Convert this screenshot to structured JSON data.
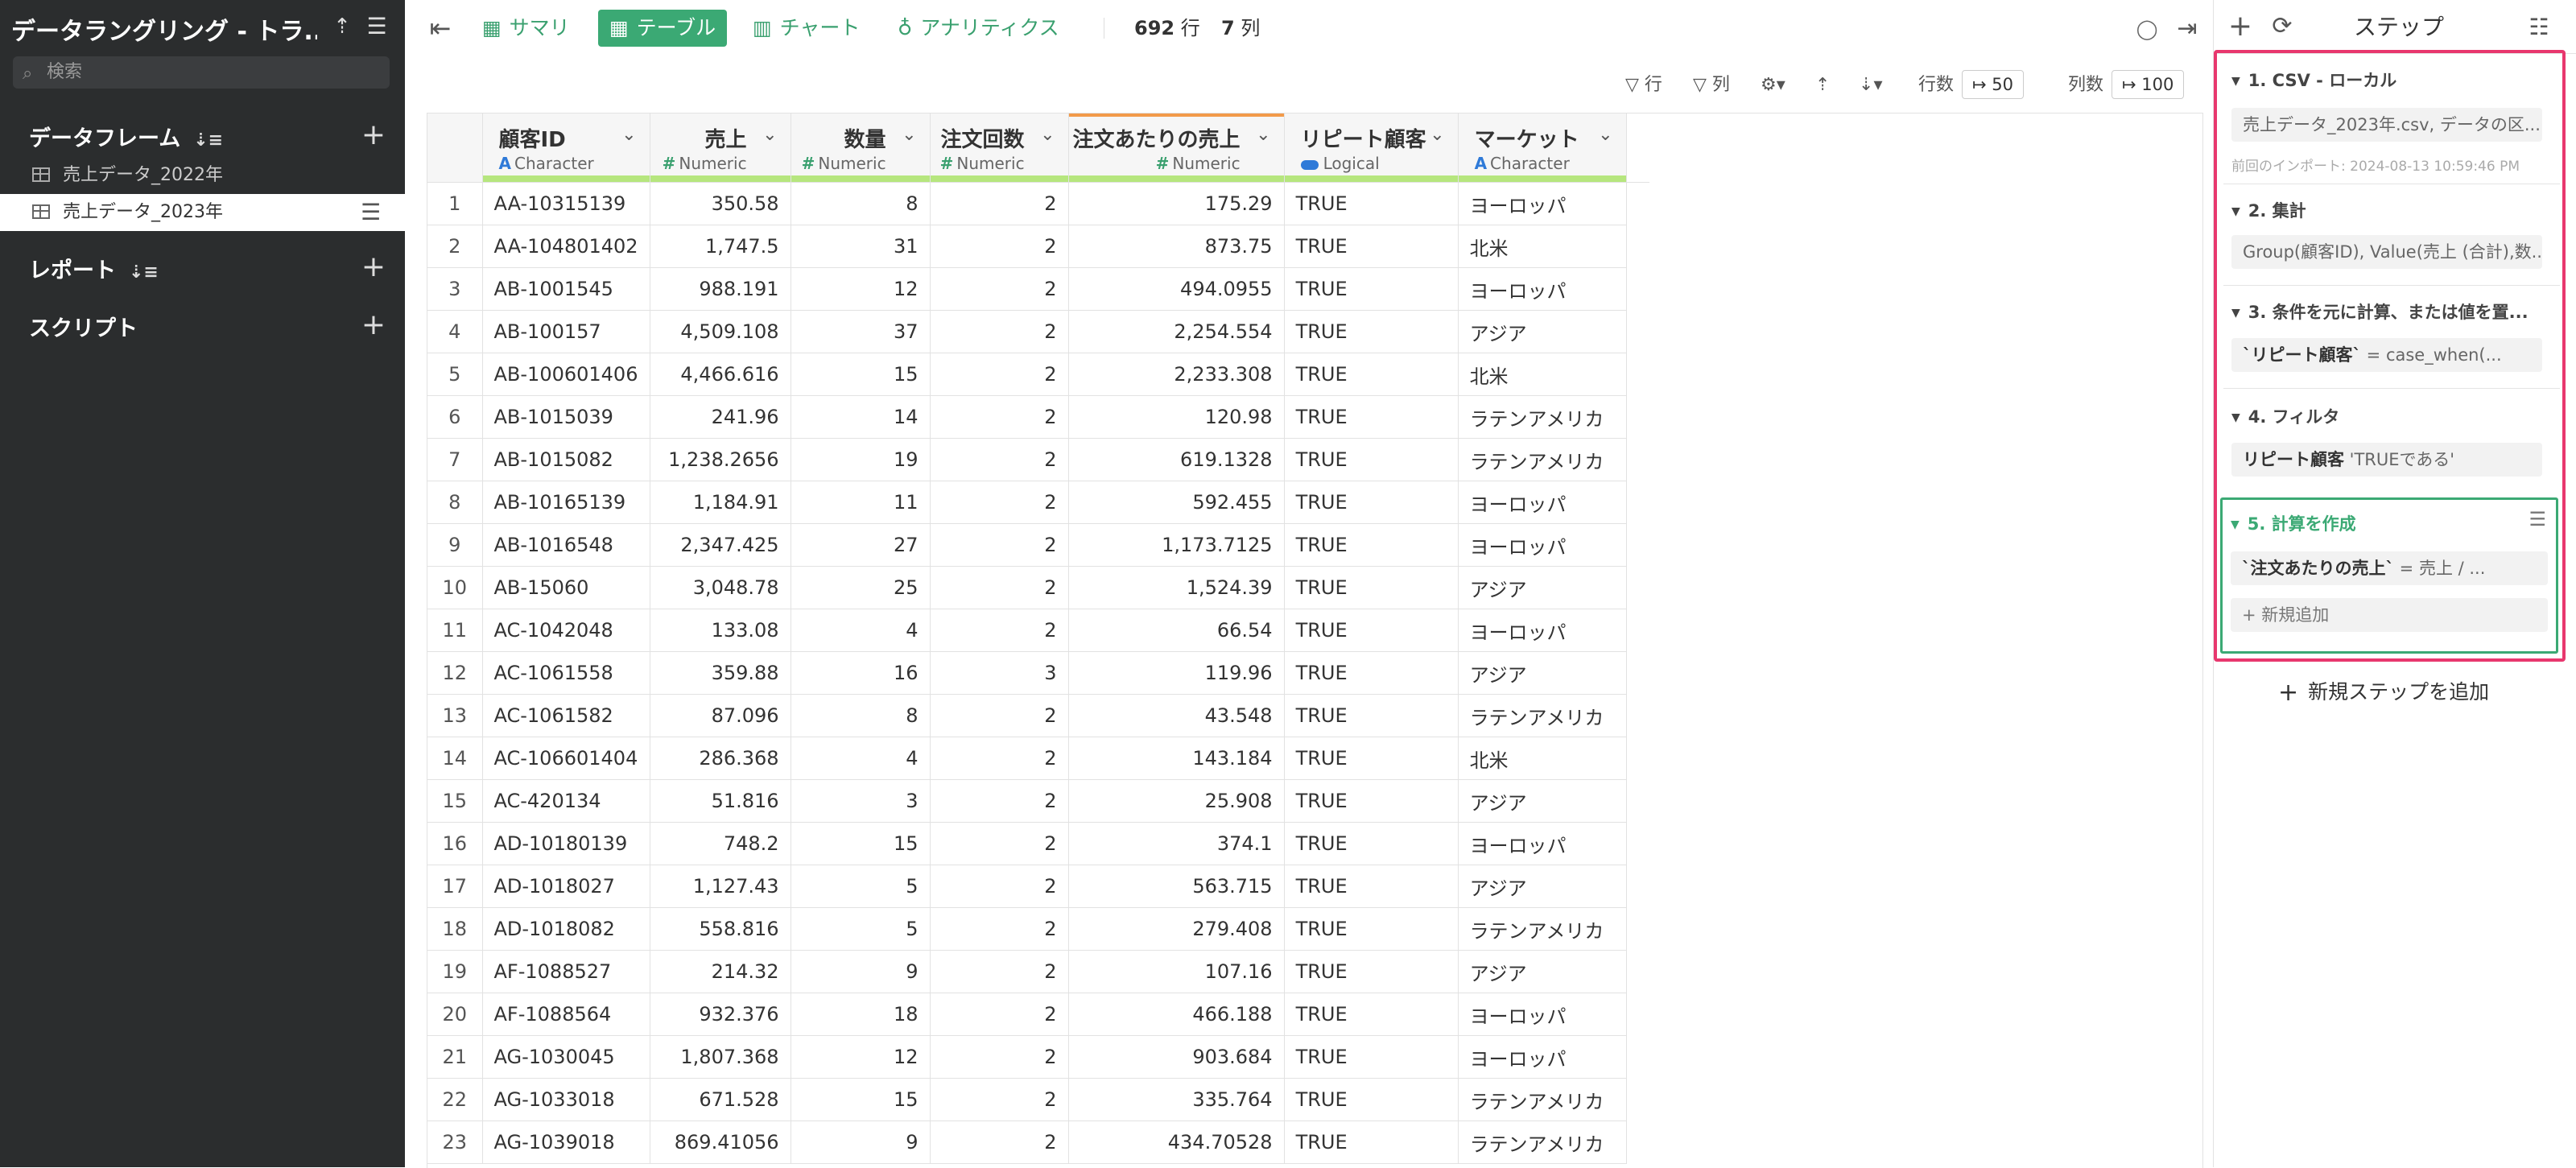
{
  "sidebar": {
    "title": "データラングリング - トラ...",
    "search_placeholder": "検索",
    "dataframes_label": "データフレーム",
    "items": [
      {
        "label": "売上データ_2022年"
      },
      {
        "label": "売上データ_2023年"
      }
    ],
    "reports_label": "レポート",
    "scripts_label": "スクリプト"
  },
  "toolbar": {
    "summary_label": "サマリ",
    "table_label": "テーブル",
    "chart_label": "チャート",
    "analytics_label": "アナリティクス",
    "rows_count": "692",
    "rows_unit": "行",
    "cols_count": "7",
    "cols_unit": "列"
  },
  "subbar": {
    "row_filter_label": "行",
    "col_filter_label": "列",
    "rows_label": "行数",
    "rows_value": "↦ 50",
    "cols_label": "列数",
    "cols_value": "↦ 100"
  },
  "table": {
    "columns": [
      {
        "name": "顧客ID",
        "type": "Character",
        "type_kind": "character"
      },
      {
        "name": "売上",
        "type": "Numeric",
        "type_kind": "numeric"
      },
      {
        "name": "数量",
        "type": "Numeric",
        "type_kind": "numeric"
      },
      {
        "name": "注文回数",
        "type": "Numeric",
        "type_kind": "numeric"
      },
      {
        "name": "注文あたりの売上",
        "type": "Numeric",
        "type_kind": "numeric"
      },
      {
        "name": "リピート顧客",
        "type": "Logical",
        "type_kind": "logical"
      },
      {
        "name": "マーケット",
        "type": "Character",
        "type_kind": "character"
      }
    ],
    "rows": [
      [
        "1",
        "AA-10315139",
        "350.58",
        "8",
        "2",
        "175.29",
        "TRUE",
        "ヨーロッパ"
      ],
      [
        "2",
        "AA-104801402",
        "1,747.5",
        "31",
        "2",
        "873.75",
        "TRUE",
        "北米"
      ],
      [
        "3",
        "AB-1001545",
        "988.191",
        "12",
        "2",
        "494.0955",
        "TRUE",
        "ヨーロッパ"
      ],
      [
        "4",
        "AB-100157",
        "4,509.108",
        "37",
        "2",
        "2,254.554",
        "TRUE",
        "アジア"
      ],
      [
        "5",
        "AB-100601406",
        "4,466.616",
        "15",
        "2",
        "2,233.308",
        "TRUE",
        "北米"
      ],
      [
        "6",
        "AB-1015039",
        "241.96",
        "14",
        "2",
        "120.98",
        "TRUE",
        "ラテンアメリカ"
      ],
      [
        "7",
        "AB-1015082",
        "1,238.2656",
        "19",
        "2",
        "619.1328",
        "TRUE",
        "ラテンアメリカ"
      ],
      [
        "8",
        "AB-10165139",
        "1,184.91",
        "11",
        "2",
        "592.455",
        "TRUE",
        "ヨーロッパ"
      ],
      [
        "9",
        "AB-1016548",
        "2,347.425",
        "27",
        "2",
        "1,173.7125",
        "TRUE",
        "ヨーロッパ"
      ],
      [
        "10",
        "AB-15060",
        "3,048.78",
        "25",
        "2",
        "1,524.39",
        "TRUE",
        "アジア"
      ],
      [
        "11",
        "AC-1042048",
        "133.08",
        "4",
        "2",
        "66.54",
        "TRUE",
        "ヨーロッパ"
      ],
      [
        "12",
        "AC-1061558",
        "359.88",
        "16",
        "3",
        "119.96",
        "TRUE",
        "アジア"
      ],
      [
        "13",
        "AC-1061582",
        "87.096",
        "8",
        "2",
        "43.548",
        "TRUE",
        "ラテンアメリカ"
      ],
      [
        "14",
        "AC-106601404",
        "286.368",
        "4",
        "2",
        "143.184",
        "TRUE",
        "北米"
      ],
      [
        "15",
        "AC-420134",
        "51.816",
        "3",
        "2",
        "25.908",
        "TRUE",
        "アジア"
      ],
      [
        "16",
        "AD-10180139",
        "748.2",
        "15",
        "2",
        "374.1",
        "TRUE",
        "ヨーロッパ"
      ],
      [
        "17",
        "AD-1018027",
        "1,127.43",
        "5",
        "2",
        "563.715",
        "TRUE",
        "アジア"
      ],
      [
        "18",
        "AD-1018082",
        "558.816",
        "5",
        "2",
        "279.408",
        "TRUE",
        "ラテンアメリカ"
      ],
      [
        "19",
        "AF-1088527",
        "214.32",
        "9",
        "2",
        "107.16",
        "TRUE",
        "アジア"
      ],
      [
        "20",
        "AF-1088564",
        "932.376",
        "18",
        "2",
        "466.188",
        "TRUE",
        "ヨーロッパ"
      ],
      [
        "21",
        "AG-1030045",
        "1,807.368",
        "12",
        "2",
        "903.684",
        "TRUE",
        "ヨーロッパ"
      ],
      [
        "22",
        "AG-1033018",
        "671.528",
        "15",
        "2",
        "335.764",
        "TRUE",
        "ラテンアメリカ"
      ],
      [
        "23",
        "AG-1039018",
        "869.41056",
        "9",
        "2",
        "434.70528",
        "TRUE",
        "ラテンアメリカ"
      ]
    ]
  },
  "steps": {
    "title": "ステップ",
    "items": [
      {
        "title": "1. CSV - ローカル",
        "body": "売上データ_2023年.csv, データの区...",
        "sub": "前回のインポート: 2024-08-13 10:59:46 PM"
      },
      {
        "title": "2. 集計",
        "body": "Group(顧客ID), Value(売上 (合計),数..."
      },
      {
        "title": "3. 条件を元に計算、または値を置...",
        "body_bold": "`リピート顧客`",
        "body": " = case_when(..."
      },
      {
        "title": "4. フィルタ",
        "body_bold": "リピート顧客",
        "body": " 'TRUEである'"
      },
      {
        "title": "5. 計算を作成",
        "body_bold": "`注文あたりの売上`",
        "body": " = 売上 / ...",
        "add_label": "+ 新規追加"
      }
    ],
    "add_step_label": "新規ステップを追加"
  },
  "colors": {
    "accent_green": "#3ba974",
    "highlight_pink": "#e8376e",
    "sidebar_bg": "#2b2d2e"
  }
}
